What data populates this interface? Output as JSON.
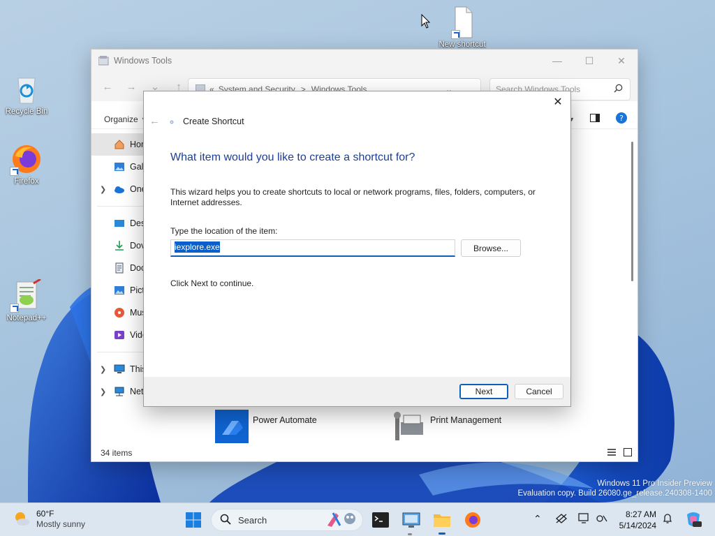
{
  "desktop": {
    "icons": [
      {
        "label": "Recycle Bin"
      },
      {
        "label": "Firefox"
      },
      {
        "label": "Notepad++"
      },
      {
        "label": "New shortcut"
      }
    ],
    "watermark_line1": "Windows 11 Pro Insider Preview",
    "watermark_line2": "Evaluation copy. Build 26080.ge_release.240308-1400"
  },
  "explorer": {
    "title": "Windows Tools",
    "address_prefix": "«",
    "address_parts": [
      "System and Security",
      ">",
      "Windows Tools"
    ],
    "search_placeholder": "Search Windows Tools",
    "organize_label": "Organize",
    "sidebar": [
      {
        "label": "Hor",
        "selected": true
      },
      {
        "label": "Gall"
      },
      {
        "label": "One"
      },
      {
        "label": "Desl"
      },
      {
        "label": "Dov"
      },
      {
        "label": "Doc"
      },
      {
        "label": "Pict"
      },
      {
        "label": "Mus"
      },
      {
        "label": "Vide"
      },
      {
        "label": "This"
      },
      {
        "label": "Network"
      }
    ],
    "items": [
      {
        "label": "Power Automate"
      },
      {
        "label": "Print Management"
      }
    ],
    "status_count": "34 items"
  },
  "wizard": {
    "title": "Create Shortcut",
    "heading": "What item would you like to create a shortcut for?",
    "description": "This wizard helps you to create shortcuts to local or network programs, files, folders, computers, or Internet addresses.",
    "location_label": "Type the location of the item:",
    "location_value": "iexplore.exe",
    "browse_label": "Browse...",
    "continue_text": "Click Next to continue.",
    "next_label": "Next",
    "cancel_label": "Cancel"
  },
  "taskbar": {
    "weather_temp": "60°F",
    "weather_condition": "Mostly sunny",
    "search_label": "Search",
    "time": "8:27 AM",
    "date": "5/14/2024"
  },
  "colors": {
    "accent": "#0f5fb8",
    "heading_blue": "#1c3f94",
    "selection": "#0a5fc9"
  }
}
